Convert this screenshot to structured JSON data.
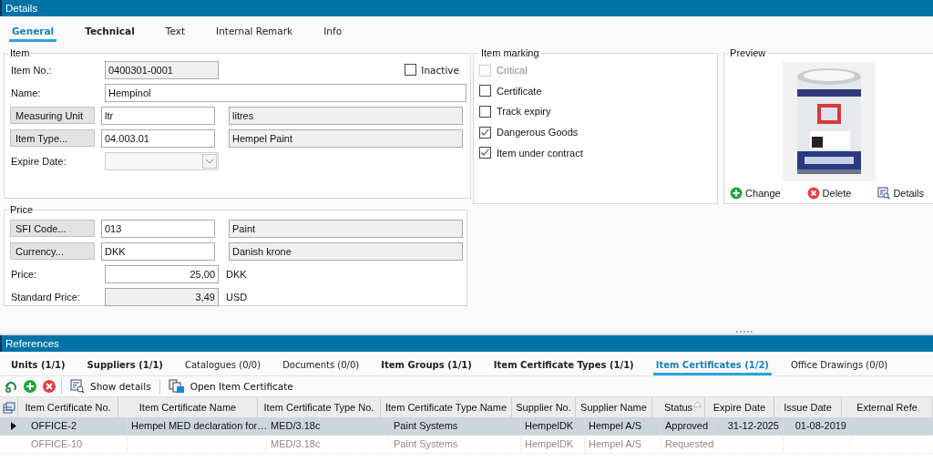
{
  "details": {
    "title": "Details",
    "tabs": [
      {
        "label": "General",
        "selected": true,
        "emphasized": true
      },
      {
        "label": "Technical",
        "selected": false,
        "emphasized": true
      },
      {
        "label": "Text",
        "selected": false,
        "emphasized": false
      },
      {
        "label": "Internal Remark",
        "selected": false,
        "emphasized": false
      },
      {
        "label": "Info",
        "selected": false,
        "emphasized": false
      }
    ],
    "item": {
      "title": "Item",
      "inactive": {
        "label": "Inactive",
        "checked": false
      },
      "fields": [
        {
          "kind": "text",
          "label": "Item No.:",
          "value": "0400301-0001",
          "readonly": true
        },
        {
          "kind": "wide",
          "label": "Name:",
          "value": "Hempinol",
          "readonly": false
        },
        {
          "kind": "lookup",
          "label": "Measuring Unit",
          "value": "ltr",
          "description": "litres",
          "readonly": false
        },
        {
          "kind": "lookup",
          "label": "Item Type...",
          "value": "04.003.01",
          "description": "Hempel Paint",
          "readonly": false
        },
        {
          "kind": "combo",
          "label": "Expire Date:",
          "readonly": true
        }
      ]
    },
    "marking": {
      "title": "Item marking",
      "items": [
        {
          "label": "Critical",
          "checked": false,
          "disabled": true
        },
        {
          "label": "Certificate",
          "checked": false,
          "disabled": false
        },
        {
          "label": "Track expiry",
          "checked": false,
          "disabled": false
        },
        {
          "label": "Dangerous Goods",
          "checked": true,
          "disabled": false
        },
        {
          "label": "Item under contract",
          "checked": true,
          "disabled": false
        }
      ]
    },
    "preview": {
      "title": "Preview",
      "actions": [
        {
          "kind": "add",
          "label": "Change"
        },
        {
          "kind": "delete",
          "label": "Delete"
        },
        {
          "kind": "details",
          "label": "Details"
        }
      ]
    },
    "price": {
      "title": "Price",
      "fields": [
        {
          "kind": "lookup",
          "label": "SFI Code...",
          "value": "013",
          "description": "Paint",
          "readonly": false
        },
        {
          "kind": "lookup",
          "label": "Currency...",
          "value": "DKK",
          "description": "Danish krone",
          "readonly": false
        },
        {
          "kind": "amount",
          "label": "Price:",
          "value": "25,00",
          "unit": "DKK",
          "readonly": false
        },
        {
          "kind": "amount",
          "label": "Standard Price:",
          "value": "3,49",
          "unit": "USD",
          "readonly": true
        }
      ]
    }
  },
  "references": {
    "title": "References",
    "tabs": [
      {
        "label": "Units (1/1)",
        "selected": false,
        "emphasized": true
      },
      {
        "label": "Suppliers (1/1)",
        "selected": false,
        "emphasized": true
      },
      {
        "label": "Catalogues (0/0)",
        "selected": false,
        "emphasized": false
      },
      {
        "label": "Documents (0/0)",
        "selected": false,
        "emphasized": false
      },
      {
        "label": "Item Groups (1/1)",
        "selected": false,
        "emphasized": true
      },
      {
        "label": "Item Certificate Types (1/1)",
        "selected": false,
        "emphasized": true
      },
      {
        "label": "Item Certificates (1/2)",
        "selected": true,
        "emphasized": true
      },
      {
        "label": "Office Drawings (0/0)",
        "selected": false,
        "emphasized": false
      }
    ],
    "toolbar": [
      {
        "kind": "refresh"
      },
      {
        "kind": "add"
      },
      {
        "kind": "delete"
      },
      {
        "kind": "separator"
      },
      {
        "kind": "details",
        "label": "Show details"
      },
      {
        "kind": "separator"
      },
      {
        "kind": "open",
        "label": "Open Item Certificate"
      }
    ],
    "table": {
      "columns": [
        {
          "label": "Item Certificate No.",
          "sorted": false
        },
        {
          "label": "Item Certificate Name",
          "sorted": false
        },
        {
          "label": "Item Certificate Type No.",
          "sorted": false
        },
        {
          "label": "Item Certificate Type Name",
          "sorted": false
        },
        {
          "label": "Supplier No.",
          "sorted": false
        },
        {
          "label": "Supplier Name",
          "sorted": false
        },
        {
          "label": "Status",
          "sorted": true
        },
        {
          "label": "Expire Date",
          "sorted": false
        },
        {
          "label": "Issue Date",
          "sorted": false
        },
        {
          "label": "External Refe",
          "sorted": false
        }
      ],
      "rows": [
        {
          "selected": true,
          "disabled": false,
          "cells": [
            "OFFICE-2",
            "Hempel MED declaration for…",
            "MED/3.18c",
            "Paint Systems",
            "HempelDK",
            "Hempel A/S",
            "Approved",
            "31-12-2025",
            "01-08-2019",
            ""
          ]
        },
        {
          "selected": false,
          "disabled": true,
          "cells": [
            "OFFICE-10",
            "",
            "MED/3.18c",
            "Paint Systems",
            "HempelDK",
            "Hempel A/S",
            "Requested",
            "",
            "",
            ""
          ]
        }
      ]
    }
  }
}
